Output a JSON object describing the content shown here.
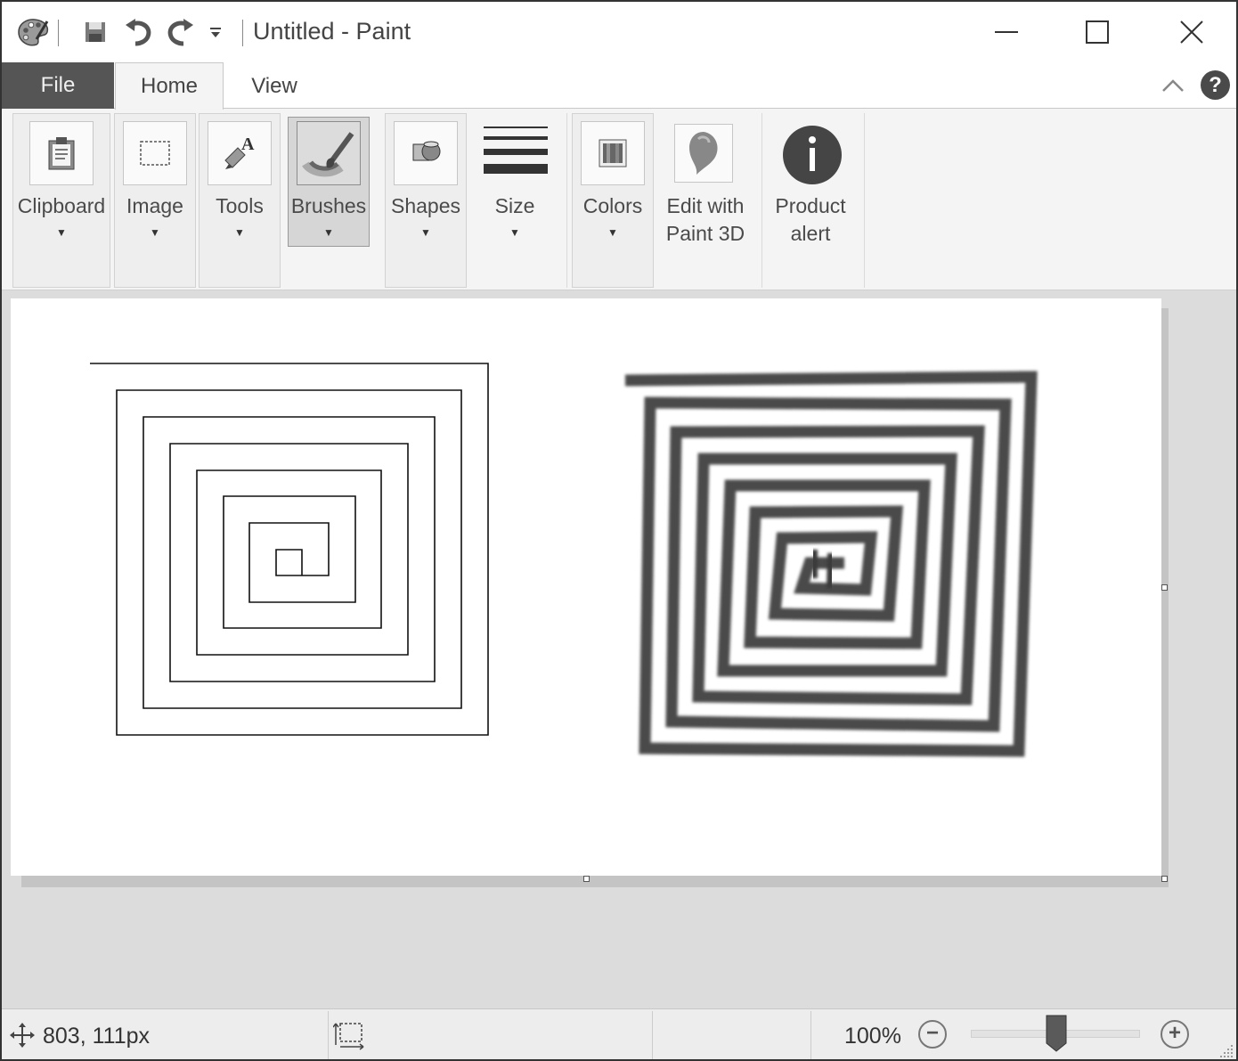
{
  "window": {
    "title": "Untitled - Paint"
  },
  "quick_access": {
    "app_icon": "palette-icon",
    "save_icon": "save-icon",
    "undo_icon": "undo-icon",
    "redo_icon": "redo-icon",
    "customize_icon": "customize-dropdown-icon"
  },
  "window_controls": [
    "minimize-icon",
    "maximize-icon",
    "close-icon"
  ],
  "menu": {
    "file": "File",
    "tabs": [
      {
        "label": "Home",
        "active": true
      },
      {
        "label": "View",
        "active": false
      }
    ],
    "help": "?"
  },
  "ribbon": {
    "groups": [
      {
        "label": "Clipboard",
        "icon": "clipboard-icon",
        "dropdown": true
      },
      {
        "label": "Image",
        "icon": "select-icon",
        "dropdown": true
      },
      {
        "label": "Tools",
        "icon": "tools-icon",
        "dropdown": true
      },
      {
        "label": "Brushes",
        "icon": "brush-icon",
        "dropdown": true,
        "selected": true
      },
      {
        "label": "Shapes",
        "icon": "shapes-icon",
        "dropdown": true
      },
      {
        "label": "Size",
        "icon": "size-lines-icon",
        "dropdown": true
      },
      {
        "label": "Colors",
        "icon": "colors-icon",
        "dropdown": true
      },
      {
        "label_lines": [
          "Edit with",
          "Paint 3D"
        ],
        "icon": "paint3d-icon"
      },
      {
        "label_lines": [
          "Product",
          "alert"
        ],
        "icon": "info-icon"
      }
    ]
  },
  "canvas": {
    "drawings": [
      "thin-square-spiral",
      "brush-square-spiral"
    ]
  },
  "status": {
    "cursor_position": "803, 111px",
    "zoom": "100%",
    "zoom_level_fraction": 0.5
  }
}
